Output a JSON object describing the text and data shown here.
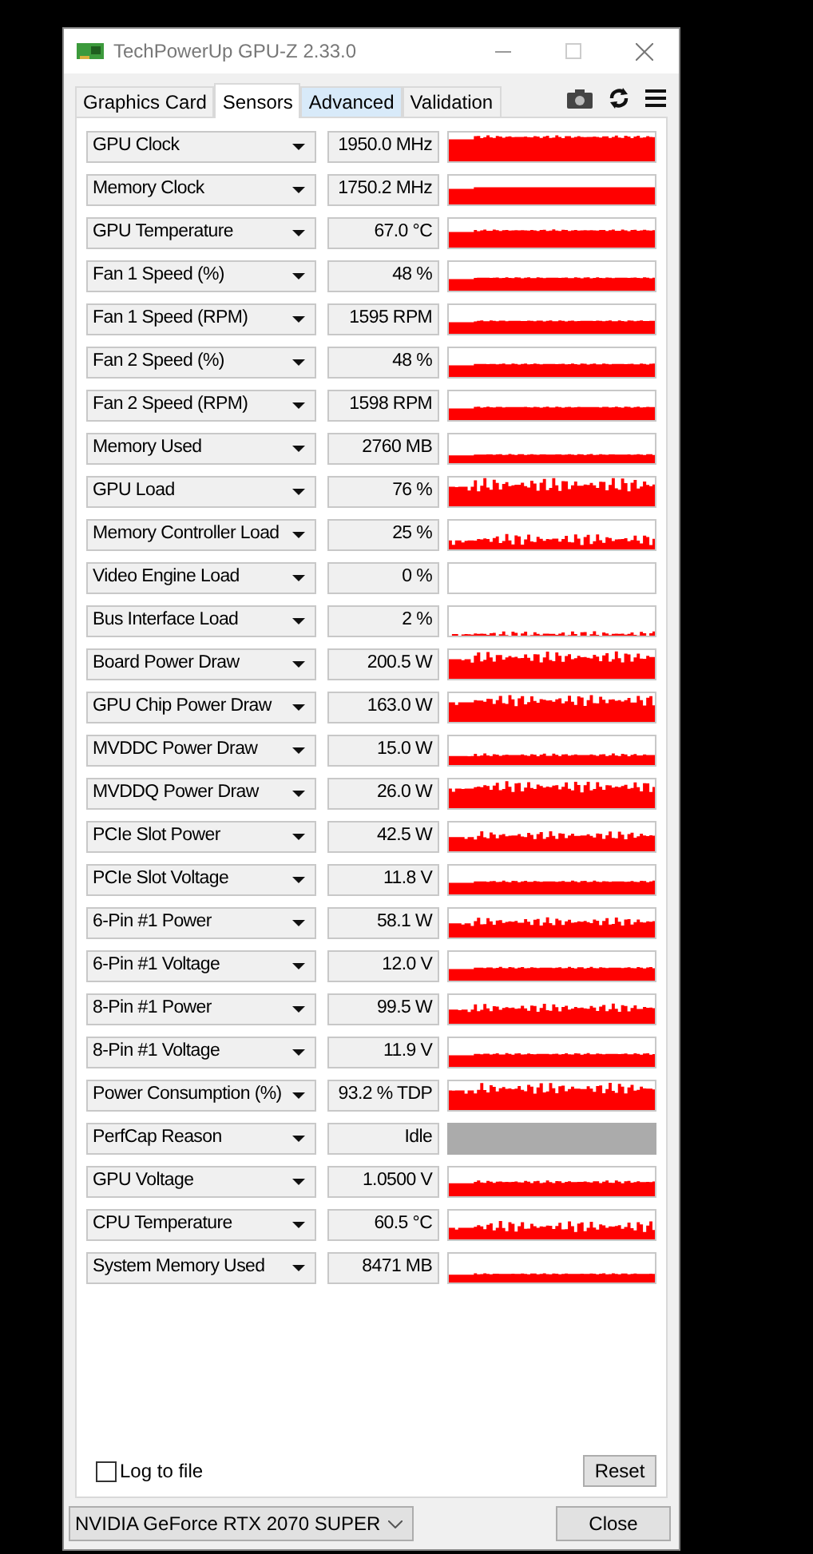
{
  "window": {
    "title": "TechPowerUp GPU-Z 2.33.0"
  },
  "tabs": [
    {
      "label": "Graphics Card",
      "selected": false,
      "hovered": false
    },
    {
      "label": "Sensors",
      "selected": true,
      "hovered": false
    },
    {
      "label": "Advanced",
      "selected": false,
      "hovered": true
    },
    {
      "label": "Validation",
      "selected": false,
      "hovered": false
    }
  ],
  "sensors": [
    {
      "name": "GPU Clock",
      "value": "1950.0 MHz",
      "kind": "graph"
    },
    {
      "name": "Memory Clock",
      "value": "1750.2 MHz",
      "kind": "graph"
    },
    {
      "name": "GPU Temperature",
      "value": "67.0 °C",
      "kind": "graph"
    },
    {
      "name": "Fan 1 Speed (%)",
      "value": "48 %",
      "kind": "graph"
    },
    {
      "name": "Fan 1 Speed (RPM)",
      "value": "1595 RPM",
      "kind": "graph"
    },
    {
      "name": "Fan 2 Speed (%)",
      "value": "48 %",
      "kind": "graph"
    },
    {
      "name": "Fan 2 Speed (RPM)",
      "value": "1598 RPM",
      "kind": "graph"
    },
    {
      "name": "Memory Used",
      "value": "2760 MB",
      "kind": "graph"
    },
    {
      "name": "GPU Load",
      "value": "76 %",
      "kind": "graph"
    },
    {
      "name": "Memory Controller Load",
      "value": "25 %",
      "kind": "graph"
    },
    {
      "name": "Video Engine Load",
      "value": "0 %",
      "kind": "graph"
    },
    {
      "name": "Bus Interface Load",
      "value": "2 %",
      "kind": "graph"
    },
    {
      "name": "Board Power Draw",
      "value": "200.5 W",
      "kind": "graph"
    },
    {
      "name": "GPU Chip Power Draw",
      "value": "163.0 W",
      "kind": "graph"
    },
    {
      "name": "MVDDC Power Draw",
      "value": "15.0 W",
      "kind": "graph"
    },
    {
      "name": "MVDDQ Power Draw",
      "value": "26.0 W",
      "kind": "graph"
    },
    {
      "name": "PCIe Slot Power",
      "value": "42.5 W",
      "kind": "graph"
    },
    {
      "name": "PCIe Slot Voltage",
      "value": "11.8 V",
      "kind": "graph"
    },
    {
      "name": "6-Pin #1 Power",
      "value": "58.1 W",
      "kind": "graph"
    },
    {
      "name": "6-Pin #1 Voltage",
      "value": "12.0 V",
      "kind": "graph"
    },
    {
      "name": "8-Pin #1 Power",
      "value": "99.5 W",
      "kind": "graph"
    },
    {
      "name": "8-Pin #1 Voltage",
      "value": "11.9 V",
      "kind": "graph"
    },
    {
      "name": "Power Consumption (%)",
      "value": "93.2 % TDP",
      "kind": "graph"
    },
    {
      "name": "PerfCap Reason",
      "value": "Idle",
      "kind": "status"
    },
    {
      "name": "GPU Voltage",
      "value": "1.0500 V",
      "kind": "graph"
    },
    {
      "name": "CPU Temperature",
      "value": "60.5 °C",
      "kind": "graph"
    },
    {
      "name": "System Memory Used",
      "value": "8471 MB",
      "kind": "graph"
    }
  ],
  "log_to_file": {
    "label": "Log to file",
    "checked": false
  },
  "reset_button": "Reset",
  "device_select": {
    "value": "NVIDIA GeForce RTX 2070 SUPER"
  },
  "close_button": "Close"
}
